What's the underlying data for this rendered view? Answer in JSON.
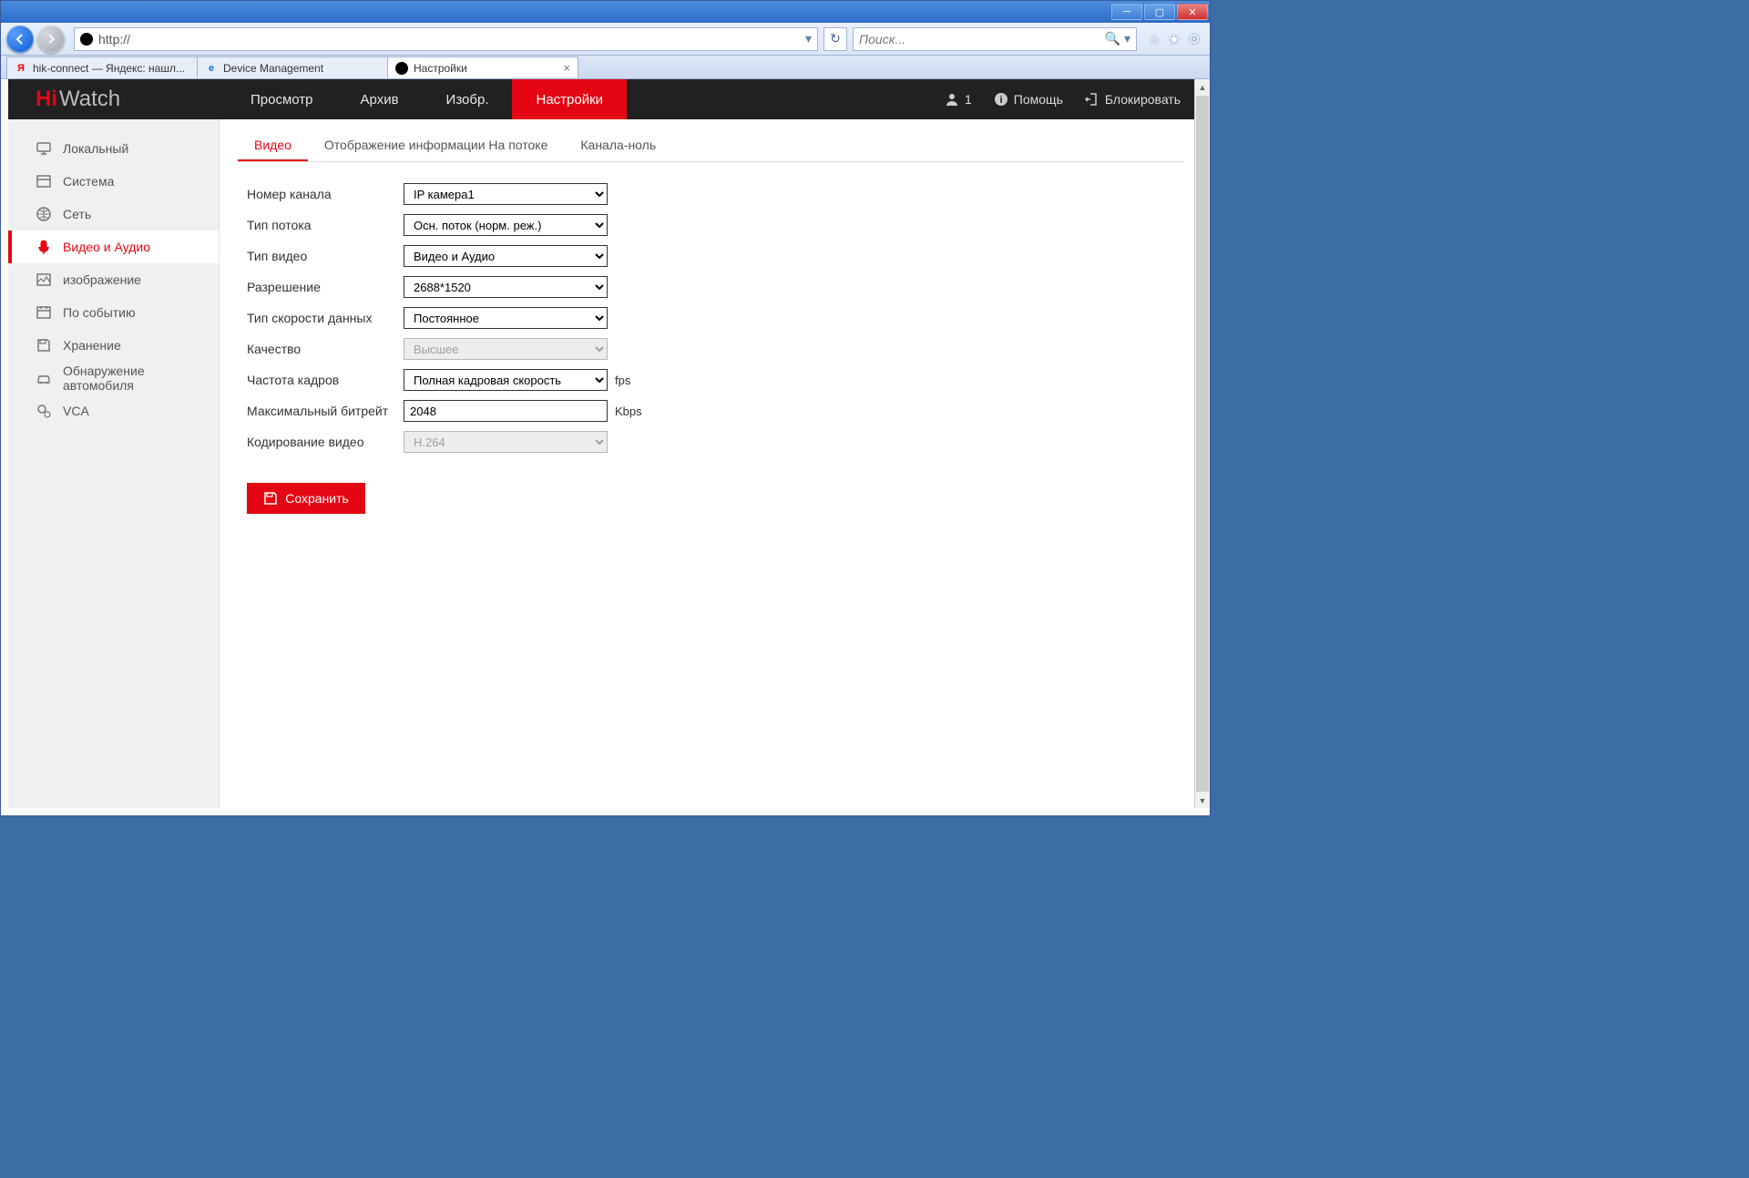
{
  "browser": {
    "url": "http://",
    "search_placeholder": "Поиск...",
    "tabs": [
      {
        "label": "hik-connect — Яндекс: нашл..."
      },
      {
        "label": "Device Management"
      },
      {
        "label": "Настройки"
      }
    ]
  },
  "app": {
    "brand_hi": "Hi",
    "brand_watch": "Watch",
    "nav": {
      "preview": "Просмотр",
      "archive": "Архив",
      "image": "Изобр.",
      "settings": "Настройки"
    },
    "user_count": "1",
    "help": "Помощь",
    "lock": "Блокировать"
  },
  "sidebar": {
    "items": [
      "Локальный",
      "Система",
      "Сеть",
      "Видео и Аудио",
      "изображение",
      "По событию",
      "Хранение",
      "Обнаружение автомобиля",
      "VCA"
    ]
  },
  "subtabs": {
    "video": "Видео",
    "osd": "Отображение информации На потоке",
    "zero": "Канала-ноль"
  },
  "form": {
    "channel_lbl": "Номер канала",
    "channel_val": "IP камера1",
    "stream_lbl": "Тип потока",
    "stream_val": "Осн. поток (норм. реж.)",
    "vtype_lbl": "Тип видео",
    "vtype_val": "Видео и Аудио",
    "res_lbl": "Разрешение",
    "res_val": "2688*1520",
    "brtype_lbl": "Тип скорости данных",
    "brtype_val": "Постоянное",
    "quality_lbl": "Качество",
    "quality_val": "Высшее",
    "fps_lbl": "Частота кадров",
    "fps_val": "Полная кадровая скорость",
    "fps_unit": "fps",
    "maxbr_lbl": "Максимальный битрейт",
    "maxbr_val": "2048",
    "maxbr_unit": "Kbps",
    "enc_lbl": "Кодирование видео",
    "enc_val": "H.264",
    "save": "Сохранить"
  }
}
